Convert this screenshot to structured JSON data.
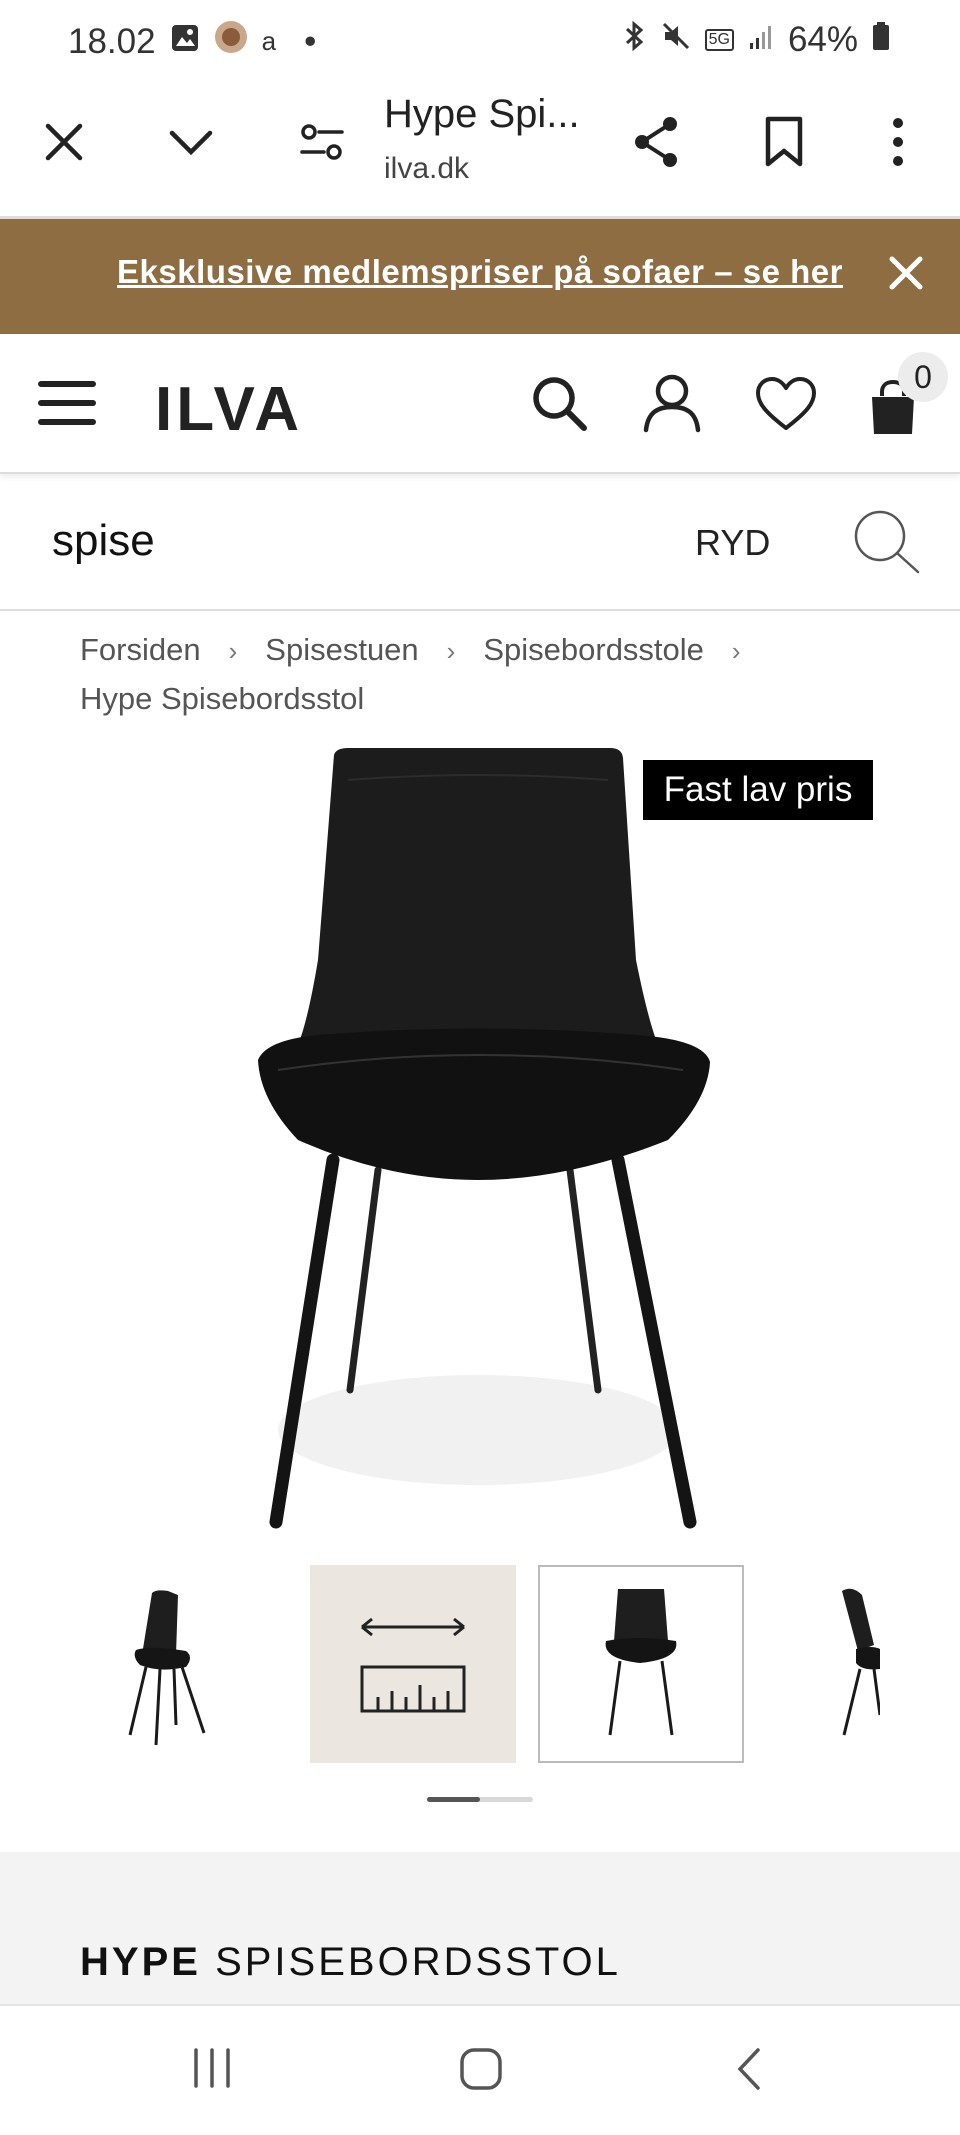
{
  "status": {
    "time": "18.02",
    "letter": "a",
    "dot": "•",
    "network": "5G",
    "battery": "64%"
  },
  "browser": {
    "tab_title": "Hype Spi...",
    "domain": "ilva.dk"
  },
  "promo": {
    "text": "Eksklusive medlemspriser på sofaer – se her"
  },
  "header": {
    "logo": "ILVA",
    "cart_count": "0"
  },
  "search": {
    "value": "spise",
    "clear_label": "RYD"
  },
  "breadcrumb": {
    "items": [
      "Forsiden",
      "Spisestuen",
      "Spisebordsstole",
      "Hype Spisebordsstol"
    ],
    "separator": "›"
  },
  "product": {
    "badge": "Fast lav pris",
    "name_bold": "HYPE",
    "name_rest": "SPISEBORDSSTOL",
    "gallery_position": 0.5
  },
  "colors": {
    "promo_bg": "#8e6d43",
    "badge_bg": "#000000",
    "info_bg": "#f3f3f3",
    "thumb_selected_bg": "#ece6e0"
  }
}
